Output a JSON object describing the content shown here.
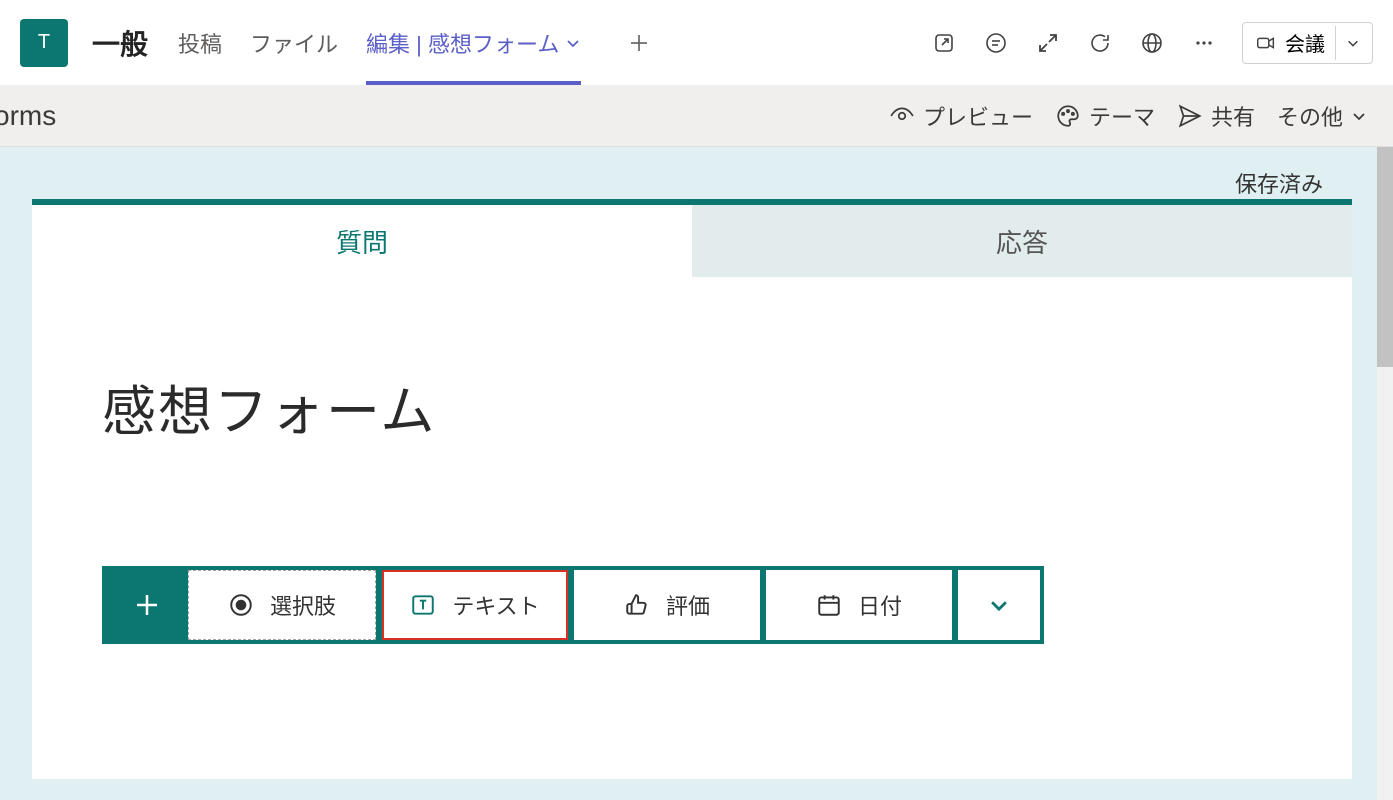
{
  "teams": {
    "avatar_letter": "T",
    "channel_name": "一般",
    "tabs": {
      "posts": "投稿",
      "files": "ファイル",
      "active": "編集 | 感想フォーム"
    },
    "meet_label": "会議"
  },
  "forms_header": {
    "app_label": "orms",
    "preview": "プレビュー",
    "theme": "テーマ",
    "share": "共有",
    "more": "その他"
  },
  "workspace": {
    "saved": "保存済み",
    "form_tabs": {
      "questions": "質問",
      "responses": "応答"
    },
    "form_title": "感想フォーム",
    "question_types": {
      "choice": "選択肢",
      "text": "テキスト",
      "rating": "評価",
      "date": "日付"
    }
  }
}
